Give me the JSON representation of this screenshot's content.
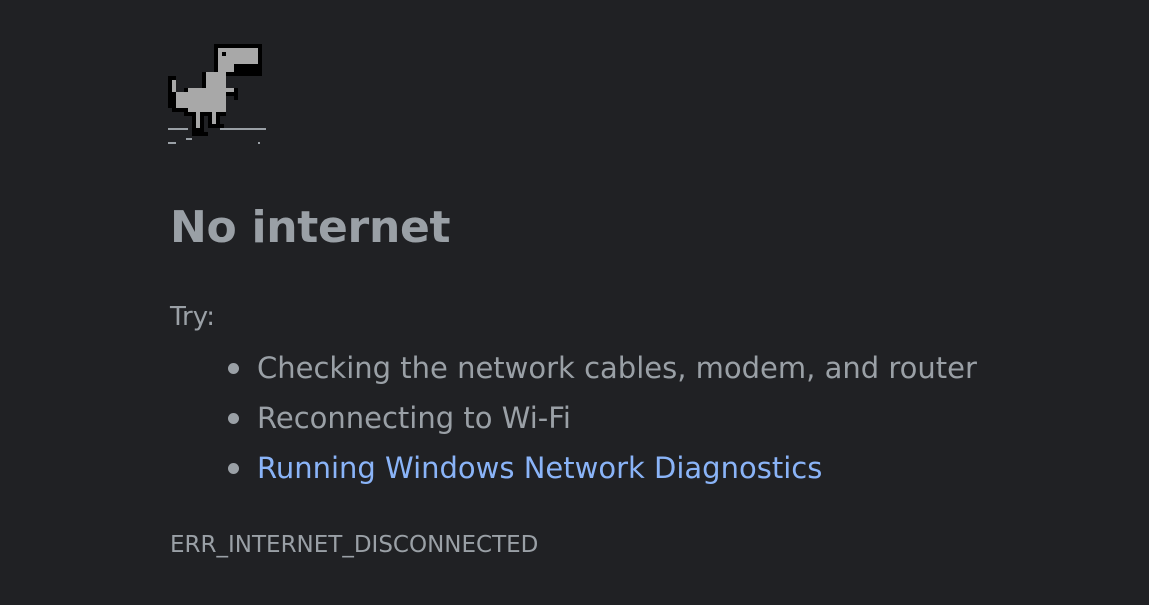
{
  "error_page": {
    "icon": "dino-icon",
    "title": "No internet",
    "try_label": "Try:",
    "suggestions": [
      {
        "text": "Checking the network cables, modem, and router",
        "is_link": false
      },
      {
        "text": "Reconnecting to Wi-Fi",
        "is_link": false
      },
      {
        "text": "Running Windows Network Diagnostics",
        "is_link": true
      }
    ],
    "error_code": "ERR_INTERNET_DISCONNECTED"
  },
  "colors": {
    "background": "#202124",
    "text": "#9aa0a6",
    "link": "#8ab4f8",
    "dino_fill": "#a8a8a8",
    "dino_outline": "#000000"
  }
}
